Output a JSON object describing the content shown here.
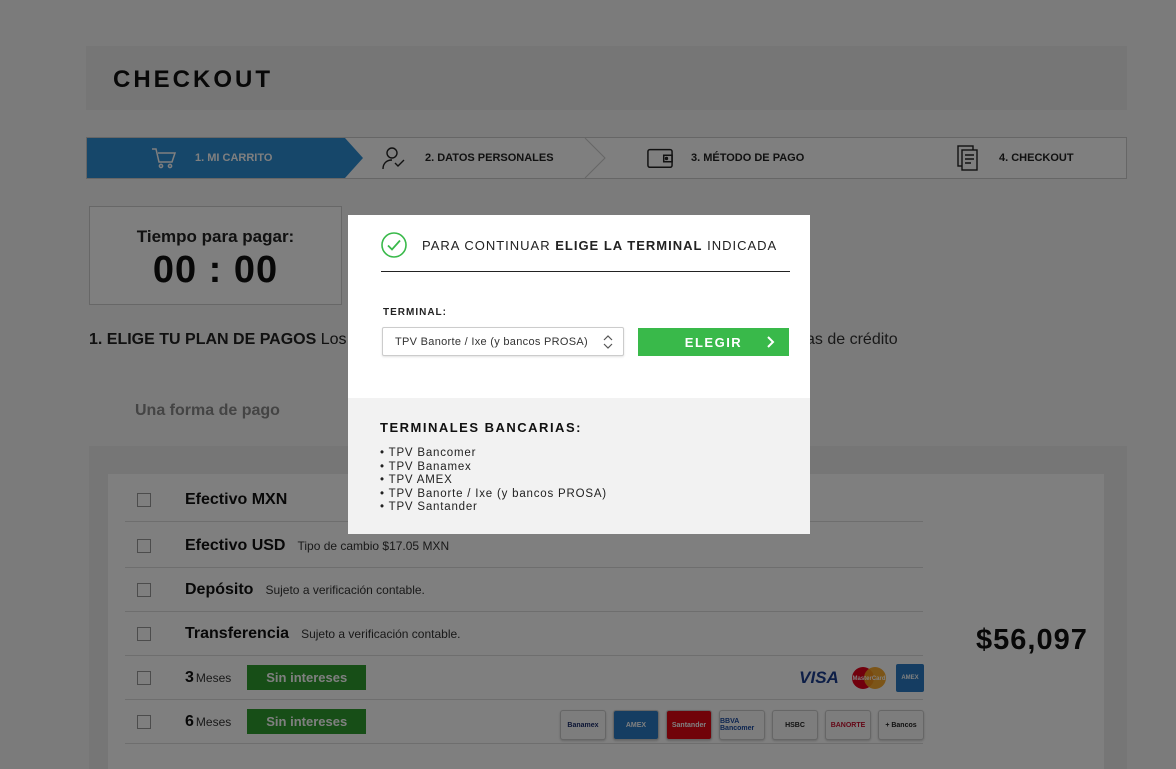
{
  "header": {
    "title": "CHECKOUT"
  },
  "steps": [
    {
      "label": "1. MI CARRITO",
      "icon": "cart-icon",
      "active": true
    },
    {
      "label": "2. DATOS PERSONALES",
      "icon": "user-icon",
      "active": false
    },
    {
      "label": "3. MÉTODO DE PAGO",
      "icon": "wallet-icon",
      "active": false
    },
    {
      "label": "4. CHECKOUT",
      "icon": "receipt-icon",
      "active": false
    }
  ],
  "timer": {
    "label": "Tiempo para pagar:",
    "value": "00 : 00"
  },
  "plan": {
    "heading": "1. ELIGE TU PLAN DE PAGOS",
    "intro": "Los",
    "tail": "as de crédito"
  },
  "tabs": {
    "one_payment": "Una forma de pago"
  },
  "payment_options": [
    {
      "name": "Efectivo MXN",
      "note": ""
    },
    {
      "name": "Efectivo USD",
      "note": "Tipo de cambio $17.05 MXN"
    },
    {
      "name": "Depósito",
      "note": "Sujeto a verificación contable."
    },
    {
      "name": "Transferencia",
      "note": "Sujeto a verificación contable."
    },
    {
      "name": "3",
      "months": "Meses",
      "badge": "Sin intereses"
    },
    {
      "name": "6",
      "months": "Meses",
      "badge": "Sin intereses"
    }
  ],
  "price": "$56,097",
  "cards": {
    "visa": "VISA",
    "mastercard": "MasterCard",
    "amex": "AMEX"
  },
  "banks": [
    "Banamex",
    "AMEX",
    "Santander",
    "BBVA Bancomer",
    "HSBC",
    "BANORTE",
    "+ Bancos"
  ],
  "modal": {
    "heading_pre": "PARA CONTINUAR ",
    "heading_bold": "ELIGE LA TERMINAL",
    "heading_post": " INDICADA",
    "terminal_label": "TERMINAL:",
    "terminal_selected": "TPV Banorte / Ixe (y bancos PROSA)",
    "button_label": "ELEGIR",
    "banks_title": "TERMINALES BANCARIAS:",
    "banks_list": [
      "TPV Bancomer",
      "TPV Banamex",
      "TPV AMEX",
      "TPV Banorte / Ixe (y bancos PROSA)",
      "TPV Santander"
    ]
  },
  "colors": {
    "accent": "#2d8fd5",
    "success": "#39b94a",
    "badge": "#2e9c2e"
  }
}
